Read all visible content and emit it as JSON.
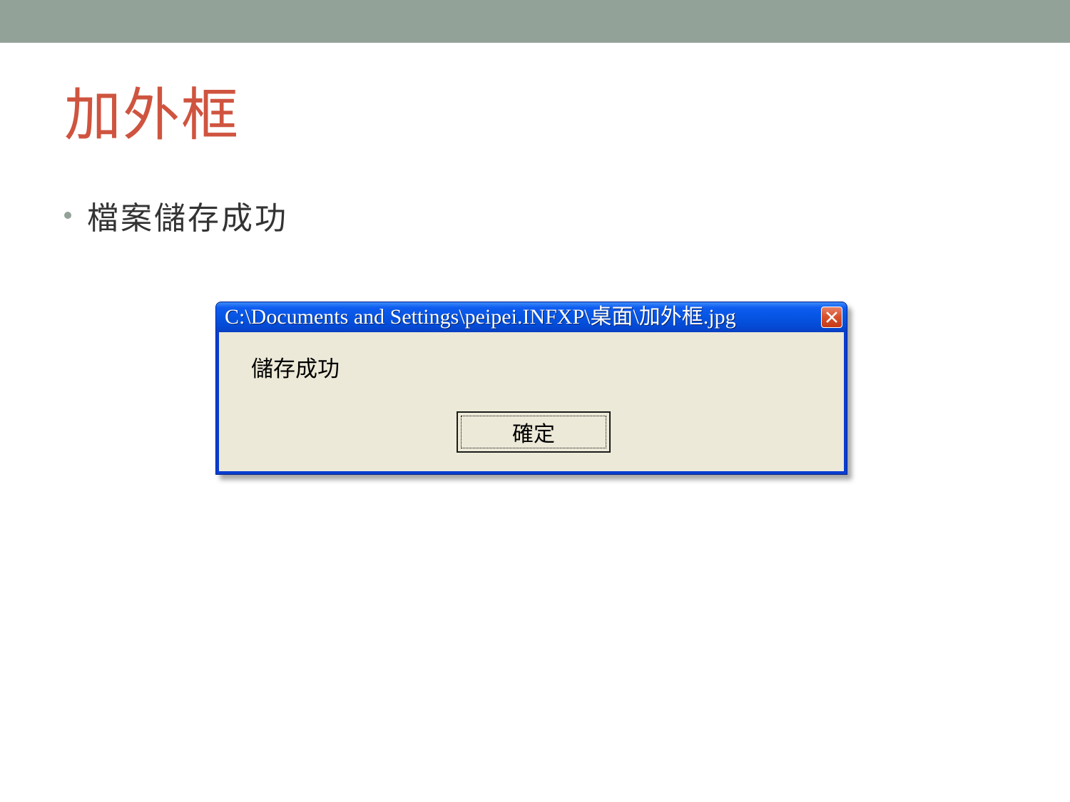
{
  "slide": {
    "title": "加外框",
    "bullets": [
      "檔案儲存成功"
    ],
    "colors": {
      "top_band": "#93a299",
      "title": "#cf543f",
      "bullet_dot": "#93a299",
      "body_text": "#333333"
    }
  },
  "dialog": {
    "title": "C:\\Documents and Settings\\peipei.INFXP\\桌面\\加外框.jpg",
    "message": "儲存成功",
    "ok_label": "確定",
    "close_icon": "close-icon",
    "colors": {
      "titlebar": "#0553e0",
      "client": "#ece9d8",
      "close_button": "#d8522e"
    }
  }
}
